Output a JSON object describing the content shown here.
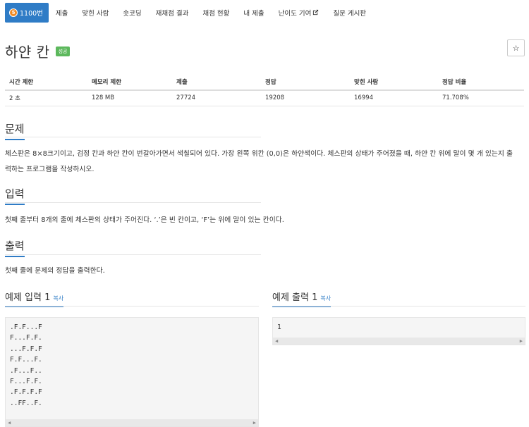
{
  "nav": {
    "tabs": [
      {
        "label": "1100번",
        "active": true
      },
      {
        "label": "제출"
      },
      {
        "label": "맞힌 사람"
      },
      {
        "label": "숏코딩"
      },
      {
        "label": "재채점 결과"
      },
      {
        "label": "채점 현황"
      },
      {
        "label": "내 제출"
      },
      {
        "label": "난이도 기여"
      },
      {
        "label": "질문 게시판"
      }
    ],
    "tier_badge": "5"
  },
  "problem": {
    "title": "하얀 칸",
    "result_badge": "성공",
    "star": "☆"
  },
  "info": {
    "headers": [
      "시간 제한",
      "메모리 제한",
      "제출",
      "정답",
      "맞힌 사람",
      "정답 비율"
    ],
    "values": [
      "2 초",
      "128 MB",
      "27724",
      "19208",
      "16994",
      "71.708%"
    ]
  },
  "sections": {
    "problem_title": "문제",
    "problem_text_1": "체스판은 8×8크기이고, 검정 칸과 하얀 칸이 번갈아가면서 색칠되어 있다. 가장 왼쪽 위칸 (0,0)은 하얀색이다. 체스판의 상태가 주어졌을 때, 하얀 칸 위에 말이 몇 개 있는지 출",
    "problem_text_2": "력하는 프로그램을 작성하시오.",
    "input_title": "입력",
    "input_text": "첫째 줄부터 8개의 줄에 체스판의 상태가 주어진다. ‘.’은 빈 칸이고, ‘F’는 위에 말이 있는 칸이다.",
    "output_title": "출력",
    "output_text": "첫째 줄에 문제의 정답을 출력한다."
  },
  "examples": {
    "input_title": "예제 입력 1",
    "output_title": "예제 출력 1",
    "copy_label": "복사",
    "input_lines": [
      ".F.F...F",
      "F...F.F.",
      "...F.F.F",
      "F.F...F.",
      ".F...F..",
      "F...F.F.",
      ".F.F.F.F",
      "..FF..F."
    ],
    "output_lines": [
      "1"
    ]
  }
}
